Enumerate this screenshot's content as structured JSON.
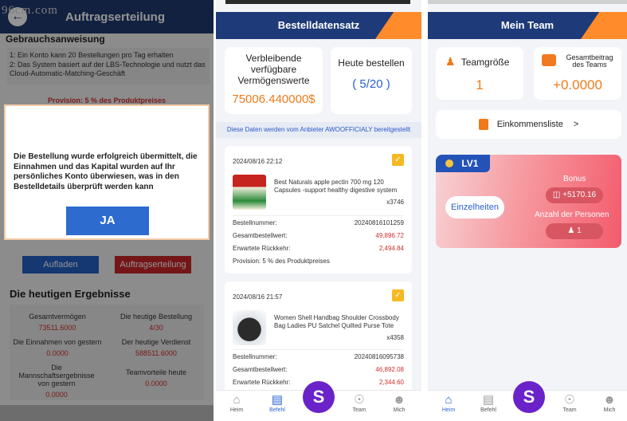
{
  "screen1": {
    "watermark": "96cm.com",
    "header_title": "Auftragserteilung",
    "back_icon": "back-arrow-icon",
    "instructions_title": "Gebrauchsanweisung",
    "rules": [
      "1: Ein Konto kann 20 Bestellungen pro Tag erhalten",
      "2: Das System basiert auf der LBS-Technologie und nutzt das Cloud-Automatic-Matching-Geschäft"
    ],
    "provision": "Provision: 5 % des Produktpreises",
    "dialog_message": "Die Bestellung wurde erfolgreich übermittelt, die Einnahmen und das Kapital wurden auf Ihr persönliches Konto überwiesen, was in den Bestelldetails überprüft werden kann",
    "dialog_button": "JA",
    "btn_topup": "Aufladen",
    "btn_order": "Auftragserteilung",
    "results_title": "Die heutigen Ergebnisse",
    "results": [
      {
        "label": "Gesamtvermögen",
        "value": "73511.6000"
      },
      {
        "label": "Die heutige Bestellung",
        "value": "4/30"
      },
      {
        "label": "Die Einnahmen von gestern",
        "value": "0.0000"
      },
      {
        "label": "Der heutige Verdienst",
        "value": "588511.6000"
      },
      {
        "label": "Die Mannschaftsergebnisse von gestern",
        "value": "0.0000"
      },
      {
        "label": "Teamvorteile heute",
        "value": "0.0000"
      }
    ]
  },
  "screen2": {
    "header_title": "Bestelldatensatz",
    "card_remaining_label": "Verbleibende verfügbare Vermögenswerte",
    "card_remaining_value": "75006.440000$",
    "card_today_label": "Heute bestellen",
    "card_today_value": "( 5/20 )",
    "provided_by": "Diese Daten werden vom Anbieter AWOOFFICIALY bereitgestellt",
    "orders": [
      {
        "date": "2024/08/16 22:12",
        "product": "Best Naturals apple pectin 700 mg 120 Capsules -support healthy digestive system",
        "qty": "x3746",
        "image_icon": "apple-pectin-bottle-image",
        "number_label": "Bestellnummer:",
        "number": "20240816101259",
        "total_label": "Gesamtbestellwert:",
        "total": "49,896.72",
        "return_label": "Erwartete Rückkehr:",
        "return": "2,494.84",
        "provision": "Provision: 5 % des Produktpreises"
      },
      {
        "date": "2024/08/16 21:57",
        "product": "Women Shell Handbag Shoulder Crossbody Bag Ladies PU Satchel Quilted Purse Tote",
        "qty": "x4358",
        "image_icon": "handbag-image",
        "number_label": "Bestellnummer:",
        "number": "20240816095738",
        "total_label": "Gesamtbestellwert:",
        "total": "46,892.08",
        "return_label": "Erwartete Rückkehr:",
        "return": "2,344.60"
      }
    ]
  },
  "screen3": {
    "header_title": "Mein Team",
    "team_size_label": "Teamgröße",
    "team_size_value": "1",
    "team_contrib_label": "Gesamtbeitrag des Teams",
    "team_contrib_value": "+0.0000",
    "income_list": "Einkommensliste",
    "income_arrow": ">",
    "level": "LV1",
    "details": "Einzelheiten",
    "bonus_label": "Bonus",
    "bonus_value": "+5170.16",
    "persons_label": "Anzahl der Personen",
    "persons_value": "1"
  },
  "tabbar": {
    "home": "Heim",
    "orders": "Befehl",
    "s_button": "S",
    "team": "Team",
    "me": "Mich"
  },
  "colors": {
    "header_blue": "#1e3a78",
    "accent_orange": "#ff8b2b",
    "value_orange": "#ef7a1a",
    "brand_purple": "#6a22c9",
    "red": "#d12f2f"
  }
}
